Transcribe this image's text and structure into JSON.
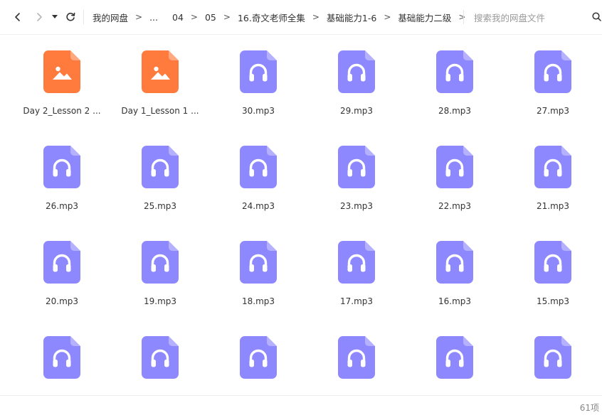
{
  "colors": {
    "image_file": "#ff7a3d",
    "audio_file": "#8e88ff"
  },
  "toolbar": {
    "back_icon": "chevron-left-icon",
    "forward_icon": "chevron-right-icon",
    "history_icon": "caret-down-icon",
    "refresh_icon": "refresh-icon"
  },
  "breadcrumb": {
    "separator": ">",
    "items": [
      "我的网盘",
      "...",
      "04",
      "05",
      "16.奇文老师全集",
      "基础能力1-6",
      "基础能力二级"
    ]
  },
  "search": {
    "placeholder": "搜索我的网盘文件",
    "icon": "search-icon"
  },
  "files": [
    {
      "name": "Day 2_Lesson 2 ...",
      "type": "image"
    },
    {
      "name": "Day 1_Lesson 1 ...",
      "type": "image"
    },
    {
      "name": "30.mp3",
      "type": "audio"
    },
    {
      "name": "29.mp3",
      "type": "audio"
    },
    {
      "name": "28.mp3",
      "type": "audio"
    },
    {
      "name": "27.mp3",
      "type": "audio"
    },
    {
      "name": "26.mp3",
      "type": "audio"
    },
    {
      "name": "25.mp3",
      "type": "audio"
    },
    {
      "name": "24.mp3",
      "type": "audio"
    },
    {
      "name": "23.mp3",
      "type": "audio"
    },
    {
      "name": "22.mp3",
      "type": "audio"
    },
    {
      "name": "21.mp3",
      "type": "audio"
    },
    {
      "name": "20.mp3",
      "type": "audio"
    },
    {
      "name": "19.mp3",
      "type": "audio"
    },
    {
      "name": "18.mp3",
      "type": "audio"
    },
    {
      "name": "17.mp3",
      "type": "audio"
    },
    {
      "name": "16.mp3",
      "type": "audio"
    },
    {
      "name": "15.mp3",
      "type": "audio"
    },
    {
      "name": "",
      "type": "audio"
    },
    {
      "name": "",
      "type": "audio"
    },
    {
      "name": "",
      "type": "audio"
    },
    {
      "name": "",
      "type": "audio"
    },
    {
      "name": "",
      "type": "audio"
    },
    {
      "name": "",
      "type": "audio"
    }
  ],
  "status": {
    "item_count": "61项"
  }
}
